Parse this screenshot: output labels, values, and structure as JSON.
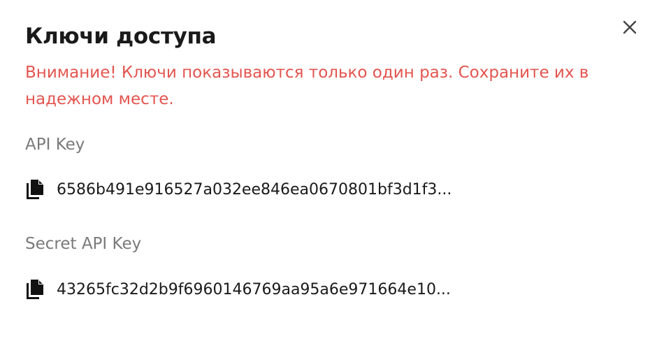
{
  "dialog": {
    "title": "Ключи доступа",
    "close_icon": "close-icon",
    "warning": "Внимание! Ключи показываются только один раз. Сохраните их в надежном месте."
  },
  "keys": [
    {
      "label": "API Key",
      "value": "6586b491e916527a032ee846ea0670801bf3d1f3...",
      "icon": "copy-icon"
    },
    {
      "label": "Secret API Key",
      "value": "43265fc32d2b9f6960146769aa95a6e971664e10...",
      "icon": "copy-icon"
    }
  ],
  "colors": {
    "warning": "#e3554f",
    "label": "#7a7a7a",
    "text": "#1a1a1a"
  }
}
